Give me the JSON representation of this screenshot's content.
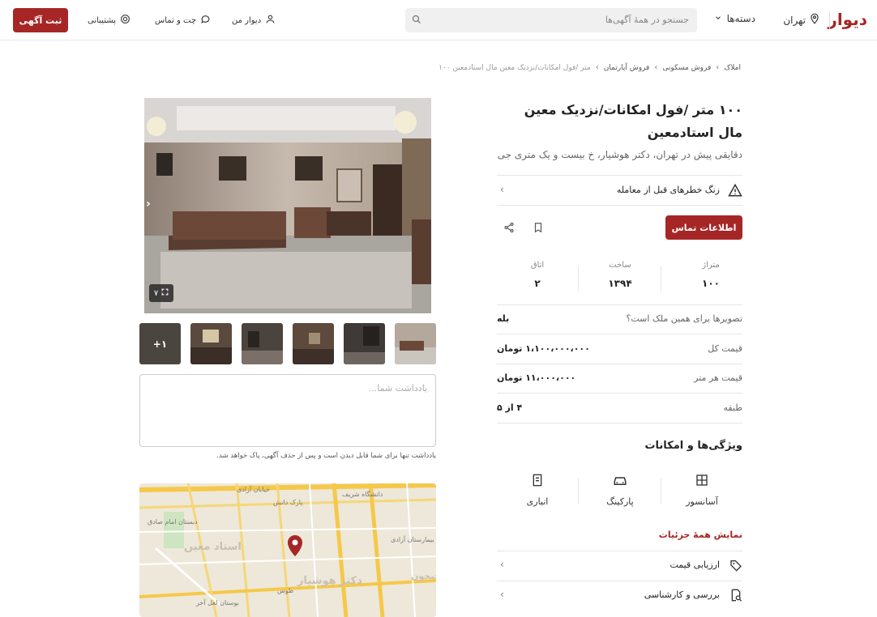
{
  "header": {
    "logo": "دیوار",
    "city": "تهران",
    "categories": "دسته‌ها",
    "search_placeholder": "جستجو در همهٔ آگهی‌ها",
    "my_divar": "دیوار من",
    "chat": "چت و تماس",
    "support": "پشتیبانی",
    "post_ad": "ثبت آگهی"
  },
  "breadcrumb": [
    "املاک",
    "فروش مسکونی",
    "فروش آپارتمان",
    "۱۰۰ متر /فول امکانات/نزدیک معین مال استادمعین"
  ],
  "ad": {
    "title": "۱۰۰ متر /فول امکانات/نزدیک معین مال استادمعین",
    "subtitle": "دقایقی پیش در تهران، دکتر هوشیار، خ بیست و یک متری جی",
    "warning": "زنگ خطرهای قبل از معامله",
    "contact_button": "اطلاعات تماس",
    "stats": [
      {
        "label": "متراژ",
        "value": "۱۰۰"
      },
      {
        "label": "ساخت",
        "value": "۱۳۹۴"
      },
      {
        "label": "اتاق",
        "value": "۲"
      }
    ],
    "info": [
      {
        "label": "تصویرها برای همین ملک است؟",
        "value": "بله"
      },
      {
        "label": "قیمت کل",
        "value": "۱،۱۰۰،۰۰۰،۰۰۰ تومان"
      },
      {
        "label": "قیمت هر متر",
        "value": "۱۱،۰۰۰،۰۰۰ تومان"
      },
      {
        "label": "طبقه",
        "value": "۴ از ۵"
      }
    ],
    "features_title": "ویژگی‌ها و امکانات",
    "features": [
      "آسانسور",
      "پارکینگ",
      "انباری"
    ],
    "show_all": "نمایش همهٔ جزئیات",
    "links": [
      "ارزیابی قیمت",
      "بررسی و کارشناسی"
    ]
  },
  "gallery": {
    "photo_count": "۷",
    "more_label": "+۱"
  },
  "note": {
    "placeholder": "یادداشت شما...",
    "hint": "یادداشت تنها برای شما قابل دیدن است و پس از حذف آگهی، پاک خواهد شد."
  },
  "map": {
    "labels": [
      "خیابان آزادی",
      "دانشگاه شریف",
      "پارک دانش",
      "بیمارستان آزادی",
      "استاد معین",
      "دکتر هوشیار",
      "جیحون",
      "بوستان لعل آخر",
      "طوس",
      "دبستان امام صادق"
    ]
  },
  "colors": {
    "brand": "#a62626"
  }
}
